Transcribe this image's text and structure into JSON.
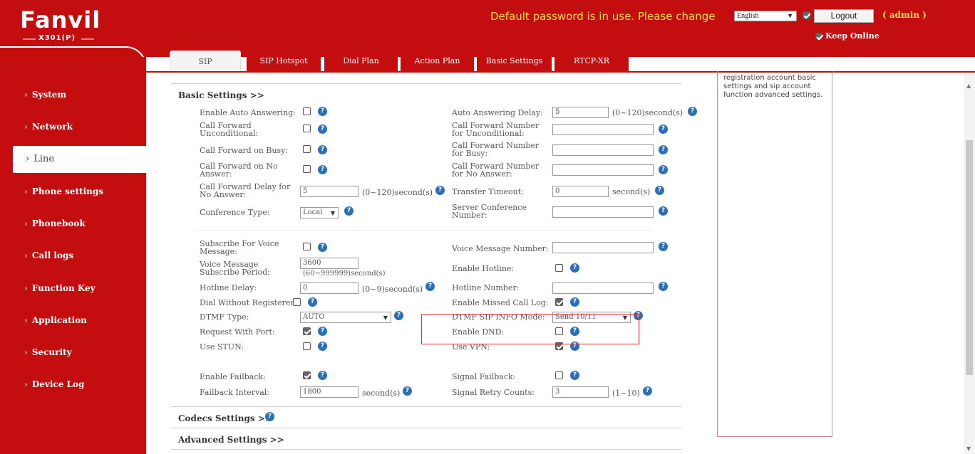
{
  "header": {
    "brand": "Fanvil",
    "model": "X301(P)",
    "warning": "Default password is in use. Please change",
    "language": "English",
    "logout_label": "Logout",
    "user": "( admin )",
    "keep_online": "Keep Online",
    "accent": "#c30d0f"
  },
  "sidebar": {
    "items": [
      {
        "label": "System"
      },
      {
        "label": "Network"
      },
      {
        "label": "Line"
      },
      {
        "label": "Phone settings"
      },
      {
        "label": "Phonebook"
      },
      {
        "label": "Call logs"
      },
      {
        "label": "Function Key"
      },
      {
        "label": "Application"
      },
      {
        "label": "Security"
      },
      {
        "label": "Device Log"
      }
    ],
    "active": "Line"
  },
  "tabs": [
    "SIP",
    "SIP Hotspot",
    "Dial Plan",
    "Action Plan",
    "Basic Settings",
    "RTCP-XR"
  ],
  "help_text": "registration account basic settings and sip account function advanced settings.",
  "sections": {
    "basic": "Basic Settings >>",
    "codecs": "Codecs Settings >>",
    "advanced": "Advanced Settings >>"
  },
  "fields": {
    "auto_answer": {
      "label": "Enable Auto Answering:",
      "checked": false
    },
    "auto_answer_delay": {
      "label": "Auto Answering Delay:",
      "value": "5",
      "unit": "(0~120)second(s)"
    },
    "cf_uncond": {
      "label": "Call Forward Unconditional:",
      "checked": false
    },
    "cf_uncond_num": {
      "label": "Call Forward Number for Unconditional:",
      "value": ""
    },
    "cf_busy": {
      "label": "Call Forward on Busy:",
      "checked": false
    },
    "cf_busy_num": {
      "label": "Call Forward Number for Busy:",
      "value": ""
    },
    "cf_noans": {
      "label": "Call Forward on No Answer:",
      "checked": false
    },
    "cf_noans_num": {
      "label": "Call Forward Number for No Answer:",
      "value": ""
    },
    "cf_delay": {
      "label": "Call Forward Delay for No Answer:",
      "value": "5",
      "unit": "(0~120)second(s)"
    },
    "transfer_timeout": {
      "label": "Transfer Timeout:",
      "value": "0",
      "unit": "second(s)"
    },
    "conf_type": {
      "label": "Conference Type:",
      "value": "Local"
    },
    "server_conf": {
      "label": "Server Conference Number:",
      "value": ""
    },
    "subscribe_vm": {
      "label": "Subscribe For Voice Message:",
      "checked": false
    },
    "vm_number": {
      "label": "Voice Message Number:",
      "value": ""
    },
    "vm_period": {
      "label": "Voice Message Subscribe Period:",
      "value": "3600",
      "unit": "(60~999999)second(s)"
    },
    "hotline_enable": {
      "label": "Enable Hotline:",
      "checked": false
    },
    "hotline_delay": {
      "label": "Hotline Delay:",
      "value": "0",
      "unit": "(0~9)second(s)"
    },
    "hotline_number": {
      "label": "Hotline Number:",
      "value": ""
    },
    "dial_unreg": {
      "label": "Dial Without Registered:",
      "checked": false
    },
    "missed_log": {
      "label": "Enable Missed Call Log:",
      "checked": true
    },
    "dtmf_type": {
      "label": "DTMF Type:",
      "value": "AUTO"
    },
    "dtmf_sip_info": {
      "label": "DTMF SIP INFO Mode:",
      "value": "Send 10/11"
    },
    "req_port": {
      "label": "Request With Port:",
      "checked": true
    },
    "dnd": {
      "label": "Enable DND:",
      "checked": false
    },
    "stun": {
      "label": "Use STUN:",
      "checked": false
    },
    "vpn": {
      "label": "Use VPN:",
      "checked": true
    },
    "failback": {
      "label": "Enable Failback:",
      "checked": true
    },
    "signal_failback": {
      "label": "Signal Failback:",
      "checked": false
    },
    "failback_interval": {
      "label": "Failback Interval:",
      "value": "1800",
      "unit": "second(s)"
    },
    "retry_counts": {
      "label": "Signal Retry Counts:",
      "value": "3",
      "unit": "(1~10)"
    }
  }
}
